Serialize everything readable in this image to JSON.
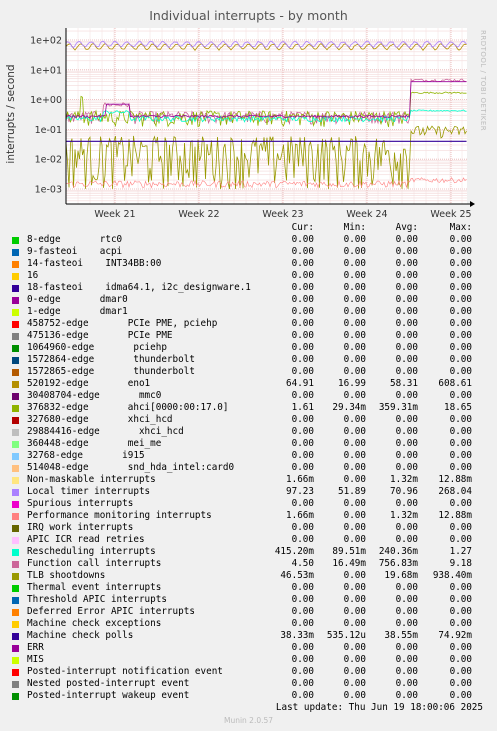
{
  "page": {
    "side_credit": "RRDTOOL / TOBI OETIKER",
    "last_update": "Last update: Thu Jun 19 18:00:06 2025",
    "munin_version": "Munin 2.0.57"
  },
  "legend_header": {
    "cur": "Cur:",
    "min": "Min:",
    "avg": "Avg:",
    "max": "Max:"
  },
  "chart_data": {
    "type": "line",
    "title": "Individual interrupts - by month",
    "ylabel": "interrupts / second",
    "yscale": "log",
    "ylim": [
      0.0005,
      200
    ],
    "yticks": [
      "1e-03",
      "1e-02",
      "1e-01",
      "1e+00",
      "1e+01",
      "1e+02"
    ],
    "xticks": [
      "Week 21",
      "Week 22",
      "Week 23",
      "Week 24",
      "Week 25"
    ],
    "grid": true,
    "series": [
      {
        "name": "8-edge       rtc0",
        "color": "#00cc00",
        "cur": "0.00",
        "min": "0.00",
        "avg": "0.00",
        "max": "0.00"
      },
      {
        "name": "9-fasteoi    acpi",
        "color": "#0066b3",
        "cur": "0.00",
        "min": "0.00",
        "avg": "0.00",
        "max": "0.00"
      },
      {
        "name": "14-fasteoi    INT34BB:00",
        "color": "#ff8000",
        "cur": "0.00",
        "min": "0.00",
        "avg": "0.00",
        "max": "0.00"
      },
      {
        "name": "16",
        "color": "#ffcc00",
        "cur": "0.00",
        "min": "0.00",
        "avg": "0.00",
        "max": "0.00"
      },
      {
        "name": "18-fasteoi    idma64.1, i2c_designware.1",
        "color": "#330099",
        "cur": "0.00",
        "min": "0.00",
        "avg": "0.00",
        "max": "0.00"
      },
      {
        "name": "0-edge       dmar0",
        "color": "#990099",
        "cur": "0.00",
        "min": "0.00",
        "avg": "0.00",
        "max": "0.00"
      },
      {
        "name": "1-edge       dmar1",
        "color": "#ccff00",
        "cur": "0.00",
        "min": "0.00",
        "avg": "0.00",
        "max": "0.00"
      },
      {
        "name": "458752-edge       PCIe PME, pciehp",
        "color": "#ff0000",
        "cur": "0.00",
        "min": "0.00",
        "avg": "0.00",
        "max": "0.00"
      },
      {
        "name": "475136-edge       PCIe PME",
        "color": "#808080",
        "cur": "0.00",
        "min": "0.00",
        "avg": "0.00",
        "max": "0.00"
      },
      {
        "name": "1064960-edge       pciehp",
        "color": "#008f00",
        "cur": "0.00",
        "min": "0.00",
        "avg": "0.00",
        "max": "0.00"
      },
      {
        "name": "1572864-edge       thunderbolt",
        "color": "#00487d",
        "cur": "0.00",
        "min": "0.00",
        "avg": "0.00",
        "max": "0.00"
      },
      {
        "name": "1572865-edge       thunderbolt",
        "color": "#b35a00",
        "cur": "0.00",
        "min": "0.00",
        "avg": "0.00",
        "max": "0.00"
      },
      {
        "name": "520192-edge       eno1",
        "color": "#b38f00",
        "cur": "64.91",
        "min": "16.99",
        "avg": "58.31",
        "max": "608.61"
      },
      {
        "name": "30408704-edge       mmc0",
        "color": "#6b006b",
        "cur": "0.00",
        "min": "0.00",
        "avg": "0.00",
        "max": "0.00"
      },
      {
        "name": "376832-edge       ahci[0000:00:17.0]",
        "color": "#8fb300",
        "cur": "1.61",
        "min": "29.34m",
        "avg": "359.31m",
        "max": "18.65"
      },
      {
        "name": "327680-edge       xhci_hcd",
        "color": "#b30000",
        "cur": "0.00",
        "min": "0.00",
        "avg": "0.00",
        "max": "0.00"
      },
      {
        "name": "29884416-edge       xhci_hcd",
        "color": "#bebebe",
        "cur": "0.00",
        "min": "0.00",
        "avg": "0.00",
        "max": "0.00"
      },
      {
        "name": "360448-edge       mei_me",
        "color": "#80ff80",
        "cur": "0.00",
        "min": "0.00",
        "avg": "0.00",
        "max": "0.00"
      },
      {
        "name": "32768-edge       i915",
        "color": "#80c9ff",
        "cur": "0.00",
        "min": "0.00",
        "avg": "0.00",
        "max": "0.00"
      },
      {
        "name": "514048-edge       snd_hda_intel:card0",
        "color": "#ffc080",
        "cur": "0.00",
        "min": "0.00",
        "avg": "0.00",
        "max": "0.00"
      },
      {
        "name": "Non-maskable interrupts",
        "color": "#ffe680",
        "cur": "1.66m",
        "min": "0.00",
        "avg": "1.32m",
        "max": "12.88m"
      },
      {
        "name": "Local timer interrupts",
        "color": "#aa80ff",
        "cur": "97.23",
        "min": "51.89",
        "avg": "70.96",
        "max": "268.04"
      },
      {
        "name": "Spurious interrupts",
        "color": "#ee00cc",
        "cur": "0.00",
        "min": "0.00",
        "avg": "0.00",
        "max": "0.00"
      },
      {
        "name": "Performance monitoring interrupts",
        "color": "#ff8080",
        "cur": "1.66m",
        "min": "0.00",
        "avg": "1.32m",
        "max": "12.88m"
      },
      {
        "name": "IRQ work interrupts",
        "color": "#666600",
        "cur": "0.00",
        "min": "0.00",
        "avg": "0.00",
        "max": "0.00"
      },
      {
        "name": "APIC ICR read retries",
        "color": "#ffbfff",
        "cur": "0.00",
        "min": "0.00",
        "avg": "0.00",
        "max": "0.00"
      },
      {
        "name": "Rescheduling interrupts",
        "color": "#00ffcc",
        "cur": "415.20m",
        "min": "89.51m",
        "avg": "240.36m",
        "max": "1.27"
      },
      {
        "name": "Function call interrupts",
        "color": "#cc6699",
        "cur": "4.50",
        "min": "16.49m",
        "avg": "756.83m",
        "max": "9.18"
      },
      {
        "name": "TLB shootdowns",
        "color": "#999900",
        "cur": "46.53m",
        "min": "0.00",
        "avg": "19.68m",
        "max": "938.40m"
      },
      {
        "name": "Thermal event interrupts",
        "color": "#00cc00",
        "cur": "0.00",
        "min": "0.00",
        "avg": "0.00",
        "max": "0.00"
      },
      {
        "name": "Threshold APIC interrupts",
        "color": "#0066b3",
        "cur": "0.00",
        "min": "0.00",
        "avg": "0.00",
        "max": "0.00"
      },
      {
        "name": "Deferred Error APIC interrupts",
        "color": "#ff8000",
        "cur": "0.00",
        "min": "0.00",
        "avg": "0.00",
        "max": "0.00"
      },
      {
        "name": "Machine check exceptions",
        "color": "#ffcc00",
        "cur": "0.00",
        "min": "0.00",
        "avg": "0.00",
        "max": "0.00"
      },
      {
        "name": "Machine check polls",
        "color": "#330099",
        "cur": "38.33m",
        "min": "535.12u",
        "avg": "38.55m",
        "max": "74.92m"
      },
      {
        "name": "ERR",
        "color": "#990099",
        "cur": "0.00",
        "min": "0.00",
        "avg": "0.00",
        "max": "0.00"
      },
      {
        "name": "MIS",
        "color": "#ccff00",
        "cur": "0.00",
        "min": "0.00",
        "avg": "0.00",
        "max": "0.00"
      },
      {
        "name": "Posted-interrupt notification event",
        "color": "#ff0000",
        "cur": "0.00",
        "min": "0.00",
        "avg": "0.00",
        "max": "0.00"
      },
      {
        "name": "Nested posted-interrupt event",
        "color": "#808080",
        "cur": "0.00",
        "min": "0.00",
        "avg": "0.00",
        "max": "0.00"
      },
      {
        "name": "Posted-interrupt wakeup event",
        "color": "#008f00",
        "cur": "0.00",
        "min": "0.00",
        "avg": "0.00",
        "max": "0.00"
      }
    ]
  }
}
